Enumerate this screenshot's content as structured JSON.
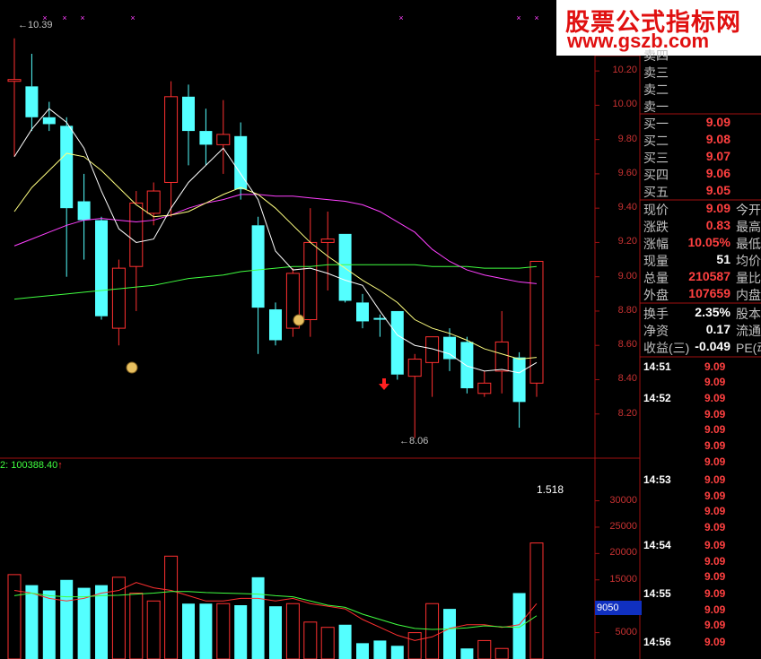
{
  "brand": {
    "title": "股票公式指标网",
    "url": "www.gszb.com"
  },
  "price_chart": {
    "high_label": "10.39",
    "low_label": "8.06",
    "axis_ticks": [
      "10.20",
      "10.00",
      "9.80",
      "9.60",
      "9.40",
      "9.20",
      "9.00",
      "8.80",
      "8.60",
      "8.40",
      "8.20"
    ]
  },
  "volume_chart": {
    "header": "2: 100388.40",
    "label_1518": "1.518",
    "axis_ticks": [
      "30000",
      "25000",
      "20000",
      "15000",
      "5000"
    ],
    "current_tag": "9050"
  },
  "quote": {
    "sell": [
      {
        "label": "卖四"
      },
      {
        "label": "卖三"
      },
      {
        "label": "卖二"
      },
      {
        "label": "卖一"
      }
    ],
    "buy": [
      {
        "label": "买一",
        "price": "9.09"
      },
      {
        "label": "买二",
        "price": "9.08"
      },
      {
        "label": "买三",
        "price": "9.07"
      },
      {
        "label": "买四",
        "price": "9.06"
      },
      {
        "label": "买五",
        "price": "9.05"
      }
    ],
    "stats": [
      {
        "label": "现价",
        "value": "9.09",
        "extra": "今开"
      },
      {
        "label": "涨跌",
        "value": "0.83",
        "extra": "最高"
      },
      {
        "label": "涨幅",
        "value": "10.05%",
        "extra": "最低"
      },
      {
        "label": "现量",
        "value": "51",
        "extra": "均价"
      },
      {
        "label": "总量",
        "value": "210587",
        "extra": "量比"
      },
      {
        "label": "外盘",
        "value": "107659",
        "extra": "内盘"
      },
      {
        "label": "换手",
        "value": "2.35%",
        "extra": "股本"
      },
      {
        "label": "净资",
        "value": "0.17",
        "extra": "流通"
      },
      {
        "label": "收益(三)",
        "value": "-0.049",
        "extra": "PE(动"
      }
    ]
  },
  "ticks": [
    {
      "time": "14:51",
      "price": "9.09"
    },
    {
      "time": "",
      "price": "9.09"
    },
    {
      "time": "14:52",
      "price": "9.09"
    },
    {
      "time": "",
      "price": "9.09"
    },
    {
      "time": "",
      "price": "9.09"
    },
    {
      "time": "",
      "price": "9.09"
    },
    {
      "time": "",
      "price": "9.09"
    },
    {
      "time": "14:53",
      "price": "9.09"
    },
    {
      "time": "",
      "price": "9.09"
    },
    {
      "time": "",
      "price": "9.09"
    },
    {
      "time": "",
      "price": "9.09"
    },
    {
      "time": "14:54",
      "price": "9.09"
    },
    {
      "time": "",
      "price": "9.09"
    },
    {
      "time": "",
      "price": "9.09"
    },
    {
      "time": "14:55",
      "price": "9.09"
    },
    {
      "time": "",
      "price": "9.09"
    },
    {
      "time": "",
      "price": "9.09"
    },
    {
      "time": "14:56",
      "price": "9.09"
    }
  ],
  "colors": {
    "up": "#ff3030",
    "down": "#54ffff",
    "ma5": "#ffffff",
    "ma10": "#ffff80",
    "ma20": "#ff40ff",
    "ma60": "#40ff40",
    "grid": "#a01010"
  },
  "chart_data": {
    "type": "candlestick",
    "candles": [
      {
        "o": 10.15,
        "h": 10.39,
        "l": 9.7,
        "c": 10.15
      },
      {
        "o": 10.11,
        "h": 10.3,
        "l": 9.85,
        "c": 9.93
      },
      {
        "o": 9.93,
        "h": 10.02,
        "l": 9.85,
        "c": 9.89
      },
      {
        "o": 9.88,
        "h": 9.93,
        "l": 9.0,
        "c": 9.4
      },
      {
        "o": 9.44,
        "h": 9.6,
        "l": 9.1,
        "c": 9.33
      },
      {
        "o": 9.33,
        "h": 9.35,
        "l": 8.75,
        "c": 8.77
      },
      {
        "o": 8.7,
        "h": 9.1,
        "l": 8.6,
        "c": 9.05
      },
      {
        "o": 9.06,
        "h": 9.5,
        "l": 8.8,
        "c": 9.43
      },
      {
        "o": 9.37,
        "h": 9.55,
        "l": 9.3,
        "c": 9.5
      },
      {
        "o": 9.55,
        "h": 10.14,
        "l": 9.35,
        "c": 10.05
      },
      {
        "o": 10.05,
        "h": 10.12,
        "l": 9.65,
        "c": 9.85
      },
      {
        "o": 9.85,
        "h": 9.98,
        "l": 9.65,
        "c": 9.77
      },
      {
        "o": 9.77,
        "h": 10.03,
        "l": 9.6,
        "c": 9.83
      },
      {
        "o": 9.82,
        "h": 9.9,
        "l": 9.45,
        "c": 9.51
      },
      {
        "o": 9.3,
        "h": 9.35,
        "l": 8.55,
        "c": 8.82
      },
      {
        "o": 8.81,
        "h": 8.85,
        "l": 8.6,
        "c": 8.63
      },
      {
        "o": 8.7,
        "h": 9.05,
        "l": 8.65,
        "c": 9.02
      },
      {
        "o": 8.75,
        "h": 9.4,
        "l": 8.65,
        "c": 9.2
      },
      {
        "o": 9.2,
        "h": 9.38,
        "l": 8.92,
        "c": 9.22
      },
      {
        "o": 9.25,
        "h": 9.25,
        "l": 8.85,
        "c": 8.86
      },
      {
        "o": 8.85,
        "h": 8.9,
        "l": 8.7,
        "c": 8.74
      },
      {
        "o": 8.76,
        "h": 8.78,
        "l": 8.65,
        "c": 8.75
      },
      {
        "o": 8.8,
        "h": 8.8,
        "l": 8.4,
        "c": 8.43
      },
      {
        "o": 8.42,
        "h": 8.55,
        "l": 8.06,
        "c": 8.52
      },
      {
        "o": 8.5,
        "h": 8.65,
        "l": 8.3,
        "c": 8.65
      },
      {
        "o": 8.65,
        "h": 8.7,
        "l": 8.45,
        "c": 8.52
      },
      {
        "o": 8.62,
        "h": 8.65,
        "l": 8.32,
        "c": 8.35
      },
      {
        "o": 8.32,
        "h": 8.45,
        "l": 8.3,
        "c": 8.38
      },
      {
        "o": 8.45,
        "h": 8.8,
        "l": 8.32,
        "c": 8.62
      },
      {
        "o": 8.53,
        "h": 8.56,
        "l": 8.12,
        "c": 8.27
      },
      {
        "o": 8.38,
        "h": 9.09,
        "l": 8.3,
        "c": 9.09
      }
    ],
    "ma5": [
      9.7,
      9.86,
      9.98,
      9.9,
      9.75,
      9.5,
      9.28,
      9.2,
      9.22,
      9.4,
      9.55,
      9.65,
      9.75,
      9.6,
      9.45,
      9.15,
      9.04,
      9.05,
      9.02,
      8.98,
      8.95,
      8.8,
      8.66,
      8.6,
      8.58,
      8.55,
      8.48,
      8.45,
      8.46,
      8.44,
      8.5
    ],
    "ma10": [
      9.38,
      9.52,
      9.62,
      9.72,
      9.7,
      9.62,
      9.52,
      9.42,
      9.35,
      9.36,
      9.38,
      9.43,
      9.48,
      9.52,
      9.48,
      9.4,
      9.3,
      9.2,
      9.12,
      9.05,
      8.98,
      8.92,
      8.85,
      8.75,
      8.7,
      8.67,
      8.63,
      8.58,
      8.55,
      8.52,
      8.53
    ],
    "ma20": [
      9.18,
      9.22,
      9.26,
      9.3,
      9.33,
      9.34,
      9.33,
      9.32,
      9.33,
      9.36,
      9.4,
      9.43,
      9.45,
      9.48,
      9.48,
      9.47,
      9.47,
      9.46,
      9.45,
      9.44,
      9.42,
      9.38,
      9.32,
      9.26,
      9.16,
      9.09,
      9.04,
      9.01,
      8.99,
      8.97,
      8.96
    ],
    "ma60": [
      8.87,
      8.88,
      8.89,
      8.9,
      8.91,
      8.92,
      8.93,
      8.94,
      8.95,
      8.97,
      8.99,
      9.0,
      9.01,
      9.03,
      9.04,
      9.05,
      9.06,
      9.06,
      9.07,
      9.07,
      9.07,
      9.07,
      9.07,
      9.07,
      9.06,
      9.06,
      9.06,
      9.05,
      9.05,
      9.05,
      9.06
    ],
    "volume": [
      16000,
      14000,
      13000,
      15000,
      13500,
      14000,
      15500,
      12500,
      11000,
      19500,
      10500,
      10500,
      10500,
      10200,
      15500,
      10000,
      10500,
      7000,
      6000,
      6500,
      3000,
      3500,
      2500,
      5000,
      10500,
      9500,
      2000,
      3500,
      2000,
      12500,
      22000
    ],
    "vol_ma1": [
      13000,
      12500,
      11500,
      11000,
      11500,
      12500,
      13000,
      14500,
      13500,
      13000,
      12000,
      11000,
      11000,
      11500,
      11500,
      11000,
      11500,
      10500,
      10000,
      9500,
      7500,
      6000,
      4500,
      3500,
      4200,
      5800,
      6500,
      6500,
      6000,
      6500,
      10500
    ],
    "vol_ma2": [
      12000,
      12500,
      12000,
      11800,
      11800,
      12000,
      12100,
      12300,
      12500,
      12800,
      12800,
      12600,
      12500,
      12400,
      12300,
      12000,
      11800,
      11000,
      10200,
      9800,
      8500,
      7500,
      6500,
      5800,
      5600,
      5700,
      5900,
      6300,
      6100,
      6000,
      8200
    ],
    "price_range": [
      8.0,
      10.3
    ],
    "volume_range": [
      0,
      34000
    ]
  }
}
